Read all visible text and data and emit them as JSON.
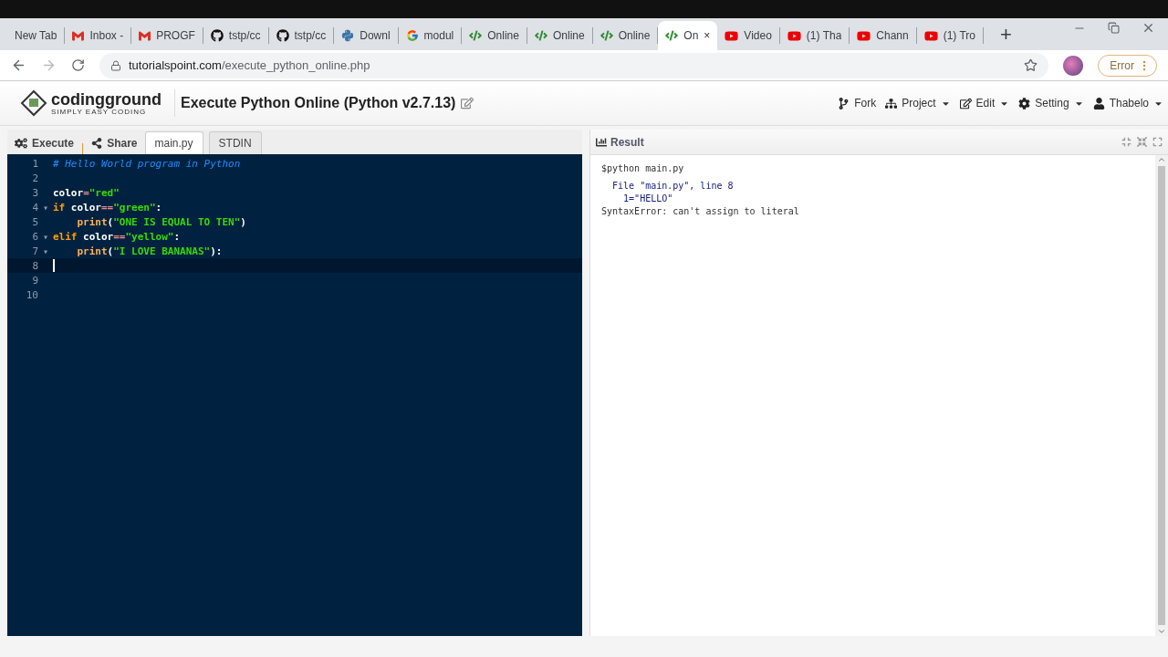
{
  "browser": {
    "tabs": [
      {
        "title": "New Tab",
        "kind": "blank",
        "selected": false
      },
      {
        "title": "Inbox -",
        "kind": "mail",
        "selected": false
      },
      {
        "title": "PROGF",
        "kind": "mail",
        "selected": false
      },
      {
        "title": "tstp/cc",
        "kind": "repo",
        "selected": false
      },
      {
        "title": "tstp/cc",
        "kind": "repo",
        "selected": false
      },
      {
        "title": "Downl",
        "kind": "python",
        "selected": false
      },
      {
        "title": "modul",
        "kind": "search",
        "selected": false
      },
      {
        "title": "Online",
        "kind": "code",
        "selected": false
      },
      {
        "title": "Online",
        "kind": "code",
        "selected": false
      },
      {
        "title": "Online",
        "kind": "code",
        "selected": false
      },
      {
        "title": "On",
        "kind": "code",
        "selected": true
      },
      {
        "title": "Video",
        "kind": "video",
        "selected": false
      },
      {
        "title": "(1) Tha",
        "kind": "video",
        "selected": false
      },
      {
        "title": "Chann",
        "kind": "video",
        "selected": false
      },
      {
        "title": "(1) Tro",
        "kind": "video",
        "selected": false
      }
    ],
    "close_tab": "×",
    "new_tab": "+",
    "address": {
      "domain": "tutorialspoint.com",
      "path": "/execute_python_online.php"
    },
    "error_badge": "Error"
  },
  "header": {
    "logo": {
      "name": "codingground",
      "tagline": "SIMPLY EASY CODING"
    },
    "title": "Execute Python Online (Python v2.7.13)",
    "menu": [
      {
        "label": "Fork",
        "kind": "fork",
        "dropdown": false
      },
      {
        "label": "Project",
        "kind": "project",
        "dropdown": true
      },
      {
        "label": "Edit",
        "kind": "edit",
        "dropdown": true
      },
      {
        "label": "Setting",
        "kind": "setting",
        "dropdown": true
      },
      {
        "label": "Thabelo",
        "kind": "user",
        "dropdown": true
      }
    ]
  },
  "toolbar": {
    "execute": "Execute",
    "separator": "|",
    "share": "Share",
    "tabs": [
      {
        "label": "main.py",
        "selected": true
      },
      {
        "label": "STDIN",
        "selected": false
      }
    ]
  },
  "editor": {
    "lines": [
      {
        "number": "1",
        "active": false,
        "tokens": [
          {
            "kind": "comment",
            "text": "# Hello World program in Python"
          }
        ]
      },
      {
        "number": "2",
        "active": false
      },
      {
        "number": "3",
        "active": false,
        "tokens": [
          {
            "kind": "plain",
            "text": "color"
          },
          {
            "kind": "op",
            "text": "="
          },
          {
            "kind": "string",
            "text": "\"red\""
          }
        ]
      },
      {
        "number": "4",
        "fold_marker": "▾",
        "active": false,
        "tokens": [
          {
            "kind": "keyword",
            "text": "if"
          },
          {
            "kind": "plain",
            "text": " color"
          },
          {
            "kind": "op",
            "text": "=="
          },
          {
            "kind": "string",
            "text": "\"green\""
          },
          {
            "kind": "plain",
            "text": ":"
          }
        ]
      },
      {
        "number": "5",
        "active": false,
        "tokens": [
          {
            "kind": "func",
            "text": "    print"
          },
          {
            "kind": "plain",
            "text": "("
          },
          {
            "kind": "string",
            "text": "\"ONE IS EQUAL TO TEN\""
          },
          {
            "kind": "plain",
            "text": ")"
          }
        ]
      },
      {
        "number": "6",
        "fold_marker": "▾",
        "active": false,
        "tokens": [
          {
            "kind": "keyword",
            "text": "elif"
          },
          {
            "kind": "plain",
            "text": " color"
          },
          {
            "kind": "op",
            "text": "=="
          },
          {
            "kind": "string",
            "text": "\"yellow\""
          },
          {
            "kind": "plain",
            "text": ":"
          }
        ]
      },
      {
        "number": "7",
        "fold_marker": "▾",
        "active": false,
        "tokens": [
          {
            "kind": "func",
            "text": "    print"
          },
          {
            "kind": "plain",
            "text": "("
          },
          {
            "kind": "string",
            "text": "\"I LOVE BANANAS\""
          },
          {
            "kind": "plain",
            "text": "):"
          }
        ]
      },
      {
        "number": "8",
        "active": true
      },
      {
        "number": "9",
        "active": false
      },
      {
        "number": "10",
        "active": false
      }
    ]
  },
  "result": {
    "title": "Result",
    "output": [
      {
        "kind": "command",
        "text": "$python main.py"
      },
      {
        "kind": "trace",
        "text": "  File \"main.py\", line 8"
      },
      {
        "kind": "trace",
        "text": "    1=\"HELLO\""
      },
      {
        "kind": "error",
        "text": "SyntaxError: can't assign to literal"
      }
    ]
  }
}
